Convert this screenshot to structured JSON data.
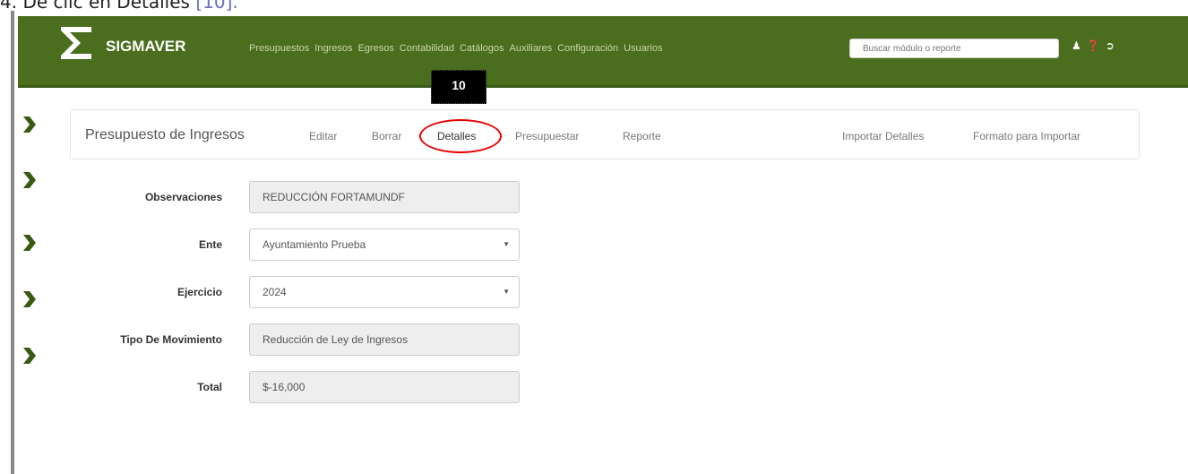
{
  "caption": {
    "text": "4. De clic en Detalles",
    "ref": "[10]."
  },
  "app": {
    "name": "SIGMAVER"
  },
  "menu": [
    "Presupuestos",
    "Ingresos",
    "Egresos",
    "Contabilidad",
    "Catálogos",
    "Auxiliares",
    "Configuración",
    "Usuarios"
  ],
  "search": {
    "placeholder": "Buscar módulo o reporte"
  },
  "nav_icons": [
    "user-icon",
    "help-icon",
    "logout-icon"
  ],
  "badge": {
    "label": "10"
  },
  "toolbar": {
    "title": "Presupuesto de Ingresos",
    "editar": "Editar",
    "borrar": "Borrar",
    "detalles": "Detalles",
    "presupuestar": "Presupuestar",
    "reporte": "Reporte",
    "importar": "Importar Detalles",
    "formato": "Formato para Importar"
  },
  "form": {
    "observaciones": {
      "label": "Observaciones",
      "value": "REDUCCIÓN FORTAMUNDF"
    },
    "ente": {
      "label": "Ente",
      "value": "Ayuntamiento Prueba"
    },
    "ejercicio": {
      "label": "Ejercicio",
      "value": "2024"
    },
    "tipo": {
      "label": "Tipo De Movimiento",
      "value": "Reducción de Ley de Ingresos"
    },
    "total": {
      "label": "Total",
      "value": "$-16,000"
    }
  },
  "colors": {
    "navbar": "#4a6e1e",
    "highlight": "#e60000",
    "chevron": "#3a5a12"
  }
}
